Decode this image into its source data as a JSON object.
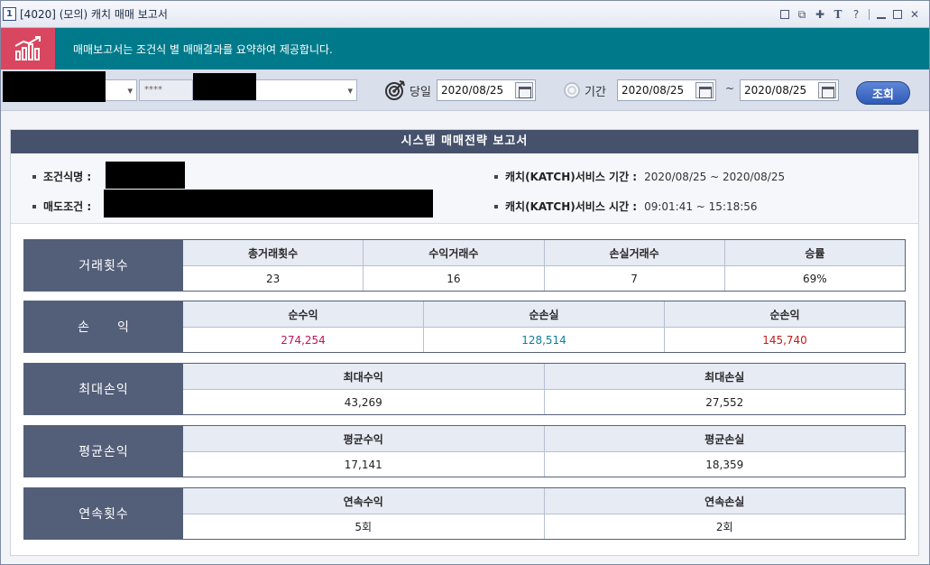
{
  "window": {
    "number": "1",
    "title": "[4020] (모의) 캐치 매매 보고서"
  },
  "banner": {
    "text": "매매보고서는 조건식 별 매매결과를 요약하여 제공합니다."
  },
  "toolbar": {
    "password_mask": "****",
    "today_label": "당일",
    "today_date": "2020/08/25",
    "period_label": "기간",
    "period_from": "2020/08/25",
    "period_sep": "~",
    "period_to": "2020/08/25",
    "search_label": "조회"
  },
  "report": {
    "title": "시스템 매매전략 보고서",
    "condition_label": "조건식명 :",
    "sell_label": "매도조건 :",
    "service_period_label": "캐치(KATCH)서비스 기간 :",
    "service_period_value": "2020/08/25 ~ 2020/08/25",
    "service_time_label": "캐치(KATCH)서비스 시간 :",
    "service_time_value": "09:01:41 ~ 15:18:56"
  },
  "sections": {
    "trades": {
      "label": "거래횟수",
      "cols": [
        {
          "head": "총거래횟수",
          "value": "23"
        },
        {
          "head": "수익거래수",
          "value": "16"
        },
        {
          "head": "손실거래수",
          "value": "7"
        },
        {
          "head": "승률",
          "value": "69%"
        }
      ]
    },
    "pnl": {
      "label": "손　　익",
      "cols": [
        {
          "head": "순수익",
          "value": "274,254"
        },
        {
          "head": "순손실",
          "value": "128,514"
        },
        {
          "head": "순손익",
          "value": "145,740"
        }
      ]
    },
    "max": {
      "label": "최대손익",
      "cols": [
        {
          "head": "최대수익",
          "value": "43,269"
        },
        {
          "head": "최대손실",
          "value": "27,552"
        }
      ]
    },
    "avg": {
      "label": "평균손익",
      "cols": [
        {
          "head": "평균수익",
          "value": "17,141"
        },
        {
          "head": "평균손실",
          "value": "18,359"
        }
      ]
    },
    "streak": {
      "label": "연속횟수",
      "cols": [
        {
          "head": "연속수익",
          "value": "5회"
        },
        {
          "head": "연속손실",
          "value": "2회"
        }
      ]
    }
  },
  "colors": {
    "profit": "#c0145a",
    "loss": "#0f7e9c",
    "net": "#c41b1b"
  }
}
